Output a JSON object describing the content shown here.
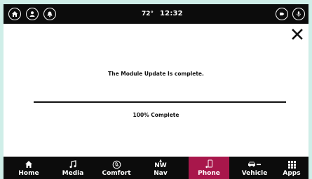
{
  "status_bar": {
    "temperature": "72°",
    "time": "12:32",
    "left_buttons": [
      "home-icon",
      "user-icon",
      "bell-icon"
    ],
    "right_buttons": [
      "media-source-icon",
      "microphone-icon"
    ]
  },
  "dialog": {
    "message": "The Module Update Is complete.",
    "progress_label": "100% Complete",
    "progress_value": 1.0
  },
  "nav": {
    "nw_label": "NW",
    "items": [
      {
        "label": "Home",
        "icon": "home-icon"
      },
      {
        "label": "Media",
        "icon": "music-note-icon"
      },
      {
        "label": "Comfort",
        "icon": "seat-icon"
      },
      {
        "label": "Nav",
        "icon": "compass-icon"
      },
      {
        "label": "Phone",
        "icon": "phone-icon",
        "active": true
      },
      {
        "label": "Vehicle",
        "icon": "car-icon"
      },
      {
        "label": "Apps",
        "icon": "grid-icon"
      }
    ]
  },
  "colors": {
    "accent": "#a8174b",
    "bar_background": "#0c0c0c",
    "progress_fill": "#111111"
  }
}
